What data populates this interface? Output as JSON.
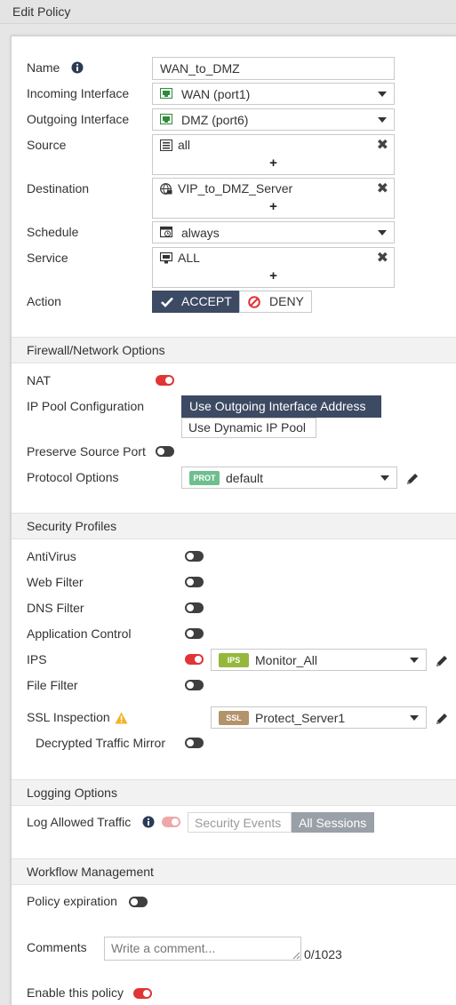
{
  "window": {
    "title": "Edit Policy"
  },
  "policy": {
    "name_label": "Name",
    "name_value": "WAN_to_DMZ",
    "incoming_label": "Incoming Interface",
    "incoming_value": "WAN (port1)",
    "outgoing_label": "Outgoing Interface",
    "outgoing_value": "DMZ (port6)",
    "source_label": "Source",
    "source_value": "all",
    "destination_label": "Destination",
    "destination_value": "VIP_to_DMZ_Server",
    "schedule_label": "Schedule",
    "schedule_value": "always",
    "service_label": "Service",
    "service_value": "ALL",
    "add_symbol": "+",
    "remove_symbol": "✖",
    "action_label": "Action",
    "accept_label": "ACCEPT",
    "deny_label": "DENY",
    "action_selected": "ACCEPT"
  },
  "firewall": {
    "section_title": "Firewall/Network Options",
    "nat_label": "NAT",
    "nat_enabled": true,
    "ip_pool_label": "IP Pool Configuration",
    "ip_pool_option_1": "Use Outgoing Interface Address",
    "ip_pool_option_2": "Use Dynamic IP Pool",
    "ip_pool_selected": "Use Outgoing Interface Address",
    "preserve_label": "Preserve Source Port",
    "preserve_enabled": false,
    "protocol_label": "Protocol Options",
    "protocol_badge": "PROT",
    "protocol_value": "default"
  },
  "security": {
    "section_title": "Security Profiles",
    "antivirus_label": "AntiVirus",
    "antivirus_enabled": false,
    "webfilter_label": "Web Filter",
    "webfilter_enabled": false,
    "dnsfilter_label": "DNS Filter",
    "dnsfilter_enabled": false,
    "appcontrol_label": "Application Control",
    "appcontrol_enabled": false,
    "ips_label": "IPS",
    "ips_enabled": true,
    "ips_badge": "IPS",
    "ips_value": "Monitor_All",
    "filefilter_label": "File Filter",
    "filefilter_enabled": false,
    "ssl_label": "SSL Inspection",
    "ssl_badge": "SSL",
    "ssl_value": "Protect_Server1",
    "decrypt_label": "Decrypted Traffic Mirror",
    "decrypt_enabled": false
  },
  "logging": {
    "section_title": "Logging Options",
    "log_label": "Log Allowed Traffic",
    "log_enabled": true,
    "option_security": "Security Events",
    "option_all": "All Sessions",
    "selected": "All Sessions"
  },
  "workflow": {
    "section_title": "Workflow Management",
    "expiration_label": "Policy expiration",
    "expiration_enabled": false
  },
  "comments": {
    "label": "Comments",
    "placeholder": "Write a comment...",
    "counter": "0/1023"
  },
  "enable": {
    "label": "Enable this policy",
    "enabled": true
  },
  "colors": {
    "toggle_on": "#e13434",
    "toggle_off": "#3f3f3f",
    "primary_dark": "#3d4a63",
    "prot_badge": "#6fbf8e",
    "ips_badge": "#95b83c",
    "ssl_badge": "#b3936a",
    "warning": "#f0b429",
    "info": "#2b3a55"
  },
  "icons": {
    "info": "info-icon",
    "interface": "network-port-icon",
    "address_group": "address-list-icon",
    "vip": "virtual-ip-icon",
    "schedule": "calendar-icon",
    "service": "monitor-icon",
    "accept": "check-icon",
    "deny": "deny-icon",
    "edit": "pencil-icon",
    "warning": "warning-icon",
    "remove": "close-icon"
  }
}
